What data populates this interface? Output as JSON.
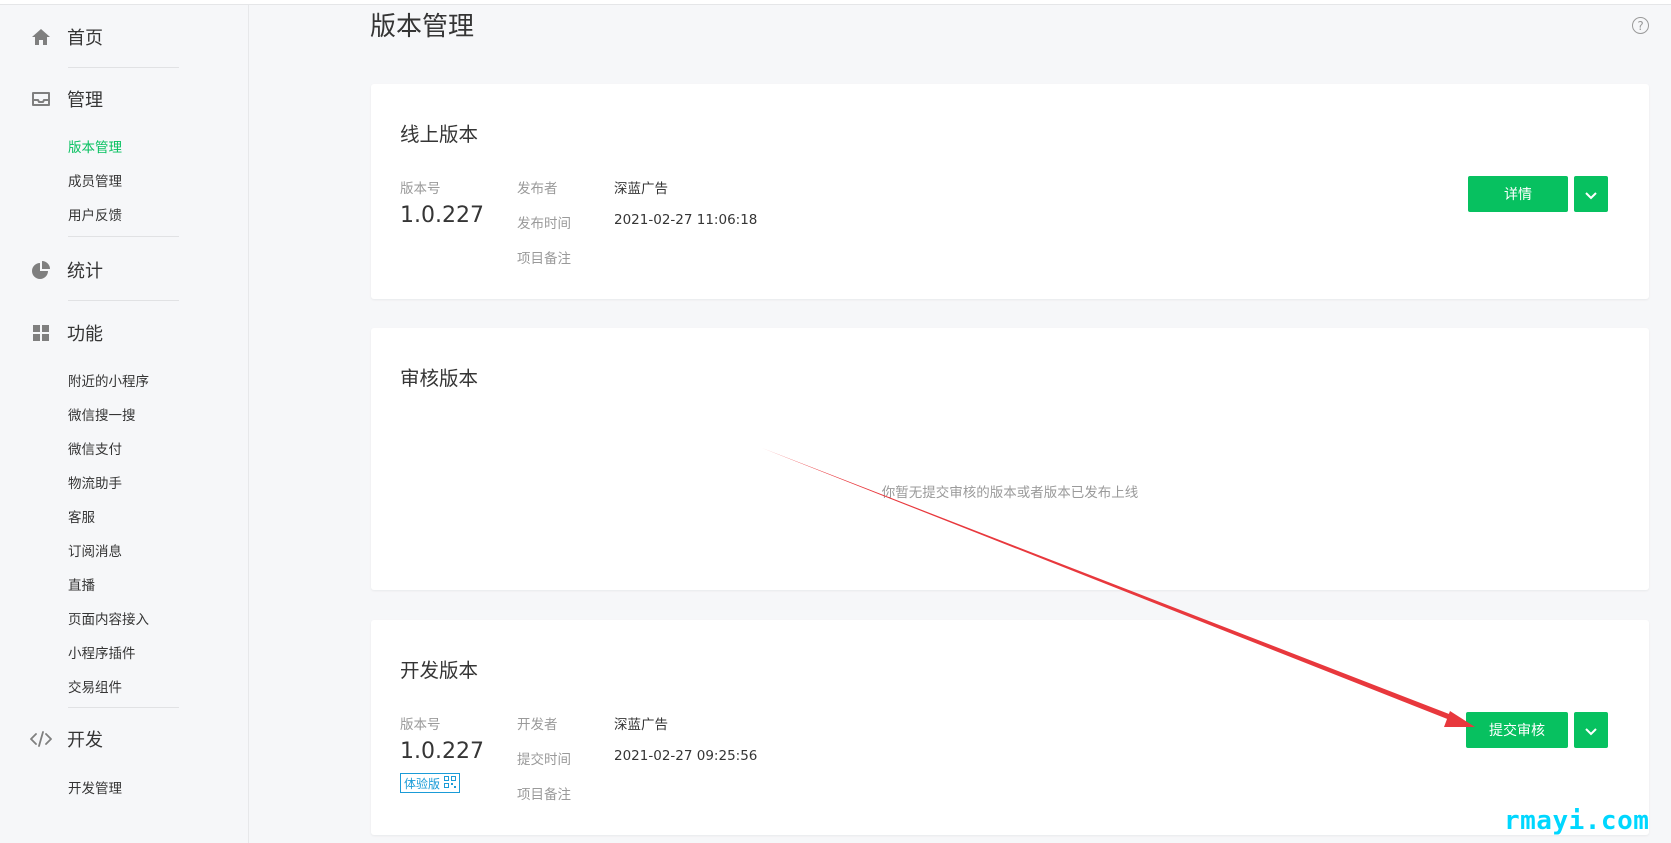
{
  "sidebar": {
    "home": {
      "label": "首页",
      "icon": "home-icon"
    },
    "manage": {
      "label": "管理",
      "icon": "inbox-icon",
      "items": [
        {
          "label": "版本管理",
          "active": true
        },
        {
          "label": "成员管理",
          "active": false
        },
        {
          "label": "用户反馈",
          "active": false
        }
      ]
    },
    "stats": {
      "label": "统计",
      "icon": "pie-chart-icon"
    },
    "features": {
      "label": "功能",
      "icon": "grid-icon",
      "items": [
        {
          "label": "附近的小程序"
        },
        {
          "label": "微信搜一搜"
        },
        {
          "label": "微信支付"
        },
        {
          "label": "物流助手"
        },
        {
          "label": "客服"
        },
        {
          "label": "订阅消息"
        },
        {
          "label": "直播"
        },
        {
          "label": "页面内容接入"
        },
        {
          "label": "小程序插件"
        },
        {
          "label": "交易组件"
        }
      ]
    },
    "dev": {
      "label": "开发",
      "icon": "code-icon",
      "items": [
        {
          "label": "开发管理"
        }
      ]
    }
  },
  "page": {
    "title": "版本管理",
    "help_icon": "question-circle-icon"
  },
  "online_version": {
    "title": "线上版本",
    "version_label": "版本号",
    "version": "1.0.227",
    "publisher_label": "发布者",
    "publisher": "深蓝广告",
    "time_label": "发布时间",
    "time": "2021-02-27 11:06:18",
    "note_label": "项目备注",
    "detail_button": "详情"
  },
  "review_version": {
    "title": "审核版本",
    "empty_text": "你暂无提交审核的版本或者版本已发布上线"
  },
  "dev_version": {
    "title": "开发版本",
    "version_label": "版本号",
    "version": "1.0.227",
    "badge": "体验版",
    "badge_icon": "qrcode-icon",
    "developer_label": "开发者",
    "developer": "深蓝广告",
    "time_label": "提交时间",
    "time": "2021-02-27 09:25:56",
    "note_label": "项目备注",
    "submit_button": "提交审核"
  },
  "watermark": "rmayi.com",
  "colors": {
    "accent": "#07c160",
    "annotation_arrow": "#e8383d",
    "badge": "#1a9bd7",
    "watermark": "#00d7ff"
  }
}
